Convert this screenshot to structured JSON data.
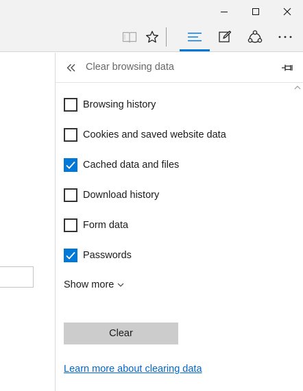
{
  "window": {
    "controls": {
      "minimize_icon": "minimize-icon",
      "maximize_icon": "maximize-icon",
      "close_icon": "close-icon"
    }
  },
  "toolbar": {
    "icons": [
      "reading-view-icon",
      "favorite-star-icon",
      "hub-icon",
      "web-note-icon",
      "share-icon",
      "more-icon"
    ],
    "active_accent": "#0078d7"
  },
  "panel": {
    "title": "Clear browsing data",
    "options": [
      {
        "label": "Browsing history",
        "checked": false
      },
      {
        "label": "Cookies and saved website data",
        "checked": false
      },
      {
        "label": "Cached data and files",
        "checked": true
      },
      {
        "label": "Download history",
        "checked": false
      },
      {
        "label": "Form data",
        "checked": false
      },
      {
        "label": "Passwords",
        "checked": true
      }
    ],
    "show_more": "Show more",
    "clear_button": "Clear",
    "learn_more_link": "Learn more about clearing data"
  },
  "colors": {
    "accent": "#0078d7",
    "link": "#0066cc",
    "button_bg": "#cccccc"
  }
}
